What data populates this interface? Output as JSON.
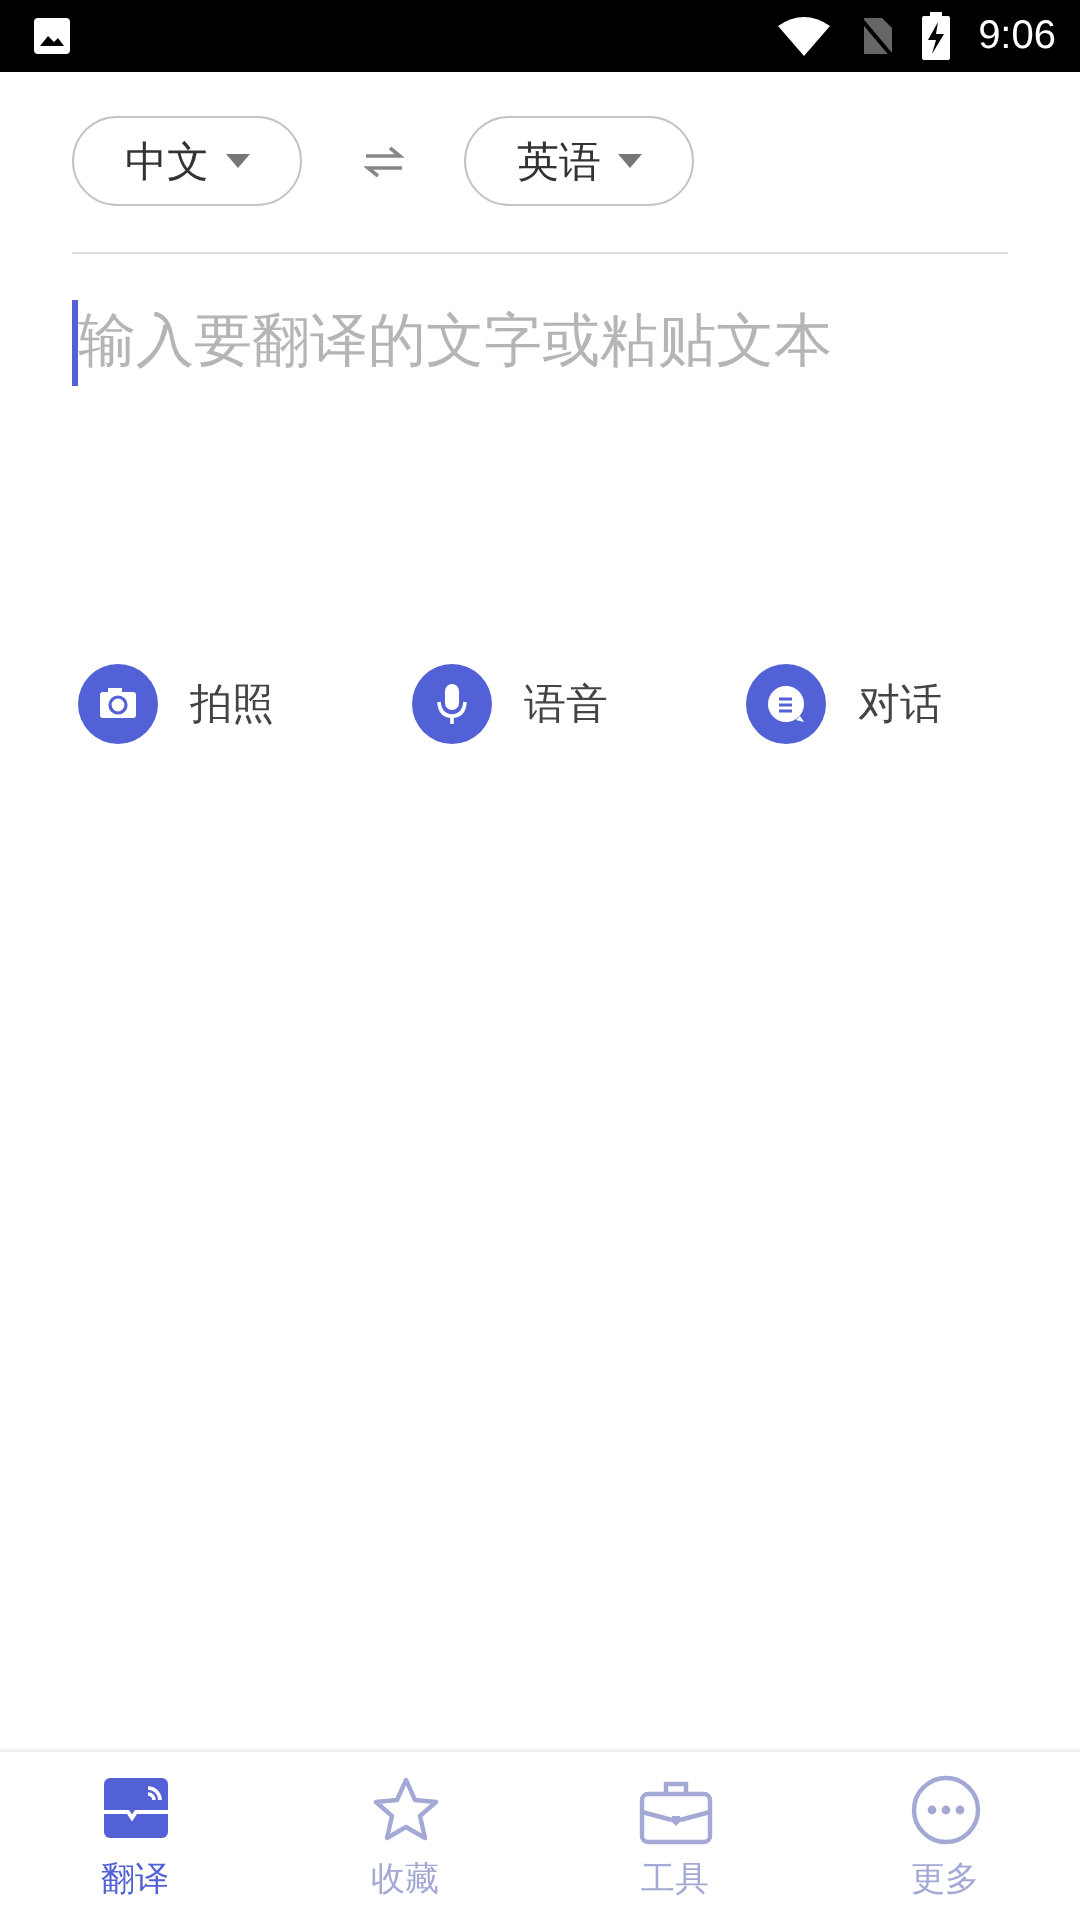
{
  "status_bar": {
    "time": "9:06"
  },
  "languages": {
    "source": "中文",
    "target": "英语"
  },
  "input": {
    "placeholder": "输入要翻译的文字或粘贴文本"
  },
  "actions": [
    {
      "label": "拍照"
    },
    {
      "label": "语音"
    },
    {
      "label": "对话"
    }
  ],
  "tabs": [
    {
      "label": "翻译",
      "selected": true
    },
    {
      "label": "收藏",
      "selected": false
    },
    {
      "label": "工具",
      "selected": false
    },
    {
      "label": "更多",
      "selected": false
    }
  ]
}
